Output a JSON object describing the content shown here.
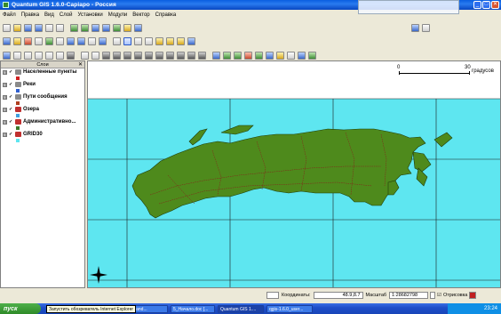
{
  "window": {
    "title": "Quantum GIS 1.6.0-Capiapo - Россия",
    "min_label": "_",
    "max_label": "□",
    "close_label": "✕"
  },
  "menu": [
    "Файл",
    "Правка",
    "Вид",
    "Слой",
    "Установки",
    "Модули",
    "Вектор",
    "Справка"
  ],
  "layers_panel": {
    "title": "Слои",
    "close": "✕",
    "layers": [
      {
        "name": "Населенные пункты",
        "expand": "⊟",
        "check": "✓",
        "icon_color": "#8a8a8a",
        "symbol_color": "#d02020"
      },
      {
        "name": "Реки",
        "expand": "⊟",
        "check": "✓",
        "icon_color": "#8a8a8a",
        "symbol_color": "#3060d0"
      },
      {
        "name": "Пути сообщения",
        "expand": "⊟",
        "check": "✓",
        "icon_color": "#8a8a8a",
        "symbol_color": "#b04020"
      },
      {
        "name": "Озера",
        "expand": "⊟",
        "check": "✓",
        "icon_color": "#c03030",
        "symbol_color": "#40a0e0"
      },
      {
        "name": "Административно...",
        "expand": "⊟",
        "check": "✓",
        "icon_color": "#c03030",
        "symbol_color": "#3a7a2a"
      },
      {
        "name": "GRID30",
        "expand": "⊟",
        "check": "✓",
        "icon_color": "#c03030",
        "symbol_color": "#5ee6f0"
      }
    ]
  },
  "map": {
    "scale_start": "0",
    "scale_end": "30",
    "scale_unit": "градусов",
    "north_arrow": "N",
    "colors": {
      "ocean": "#5ee6f0",
      "land": "#4e8a1c",
      "grid": "#1a1a1a",
      "border": "#8a1a1a"
    }
  },
  "status": {
    "coords_label": "Координаты:",
    "coords_value": "48.9,8.7",
    "scale_label": "Масштаб",
    "scale_value": "1:28682798",
    "render_label": "Отрисовка"
  },
  "taskbar": {
    "start_label": "пуск",
    "tooltip": "Запустить обозреватель Internet Explorer",
    "tasks": [
      "land...",
      "5_Начало.doc [...",
      "Quantum GIS 1....",
      "qgis-1.6.0_user..."
    ],
    "clock": "23:24"
  }
}
